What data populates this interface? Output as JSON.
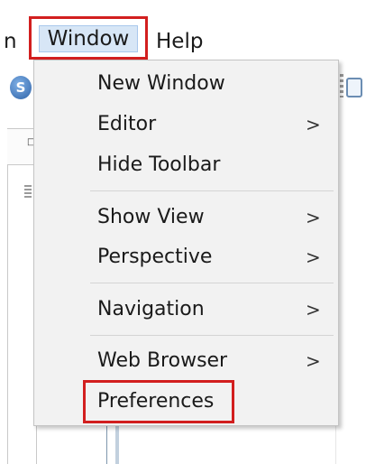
{
  "menubar": {
    "partial_label": "n",
    "window_label": "Window",
    "help_label": "Help"
  },
  "background": {
    "app_icon_glyph": "S"
  },
  "window_menu": {
    "items": [
      {
        "label": "New Window",
        "has_submenu": false
      },
      {
        "label": "Editor",
        "has_submenu": true
      },
      {
        "label": "Hide Toolbar",
        "has_submenu": false
      },
      {
        "label": "Show View",
        "has_submenu": true
      },
      {
        "label": "Perspective",
        "has_submenu": true
      },
      {
        "label": "Navigation",
        "has_submenu": true
      },
      {
        "label": "Web Browser",
        "has_submenu": true
      },
      {
        "label": "Preferences",
        "has_submenu": false
      }
    ],
    "submenu_arrow": ">"
  },
  "colors": {
    "highlight_border": "#d21f1f",
    "menu_background": "#f2f2f2",
    "active_menubar_fill": "#d7e6f6"
  }
}
